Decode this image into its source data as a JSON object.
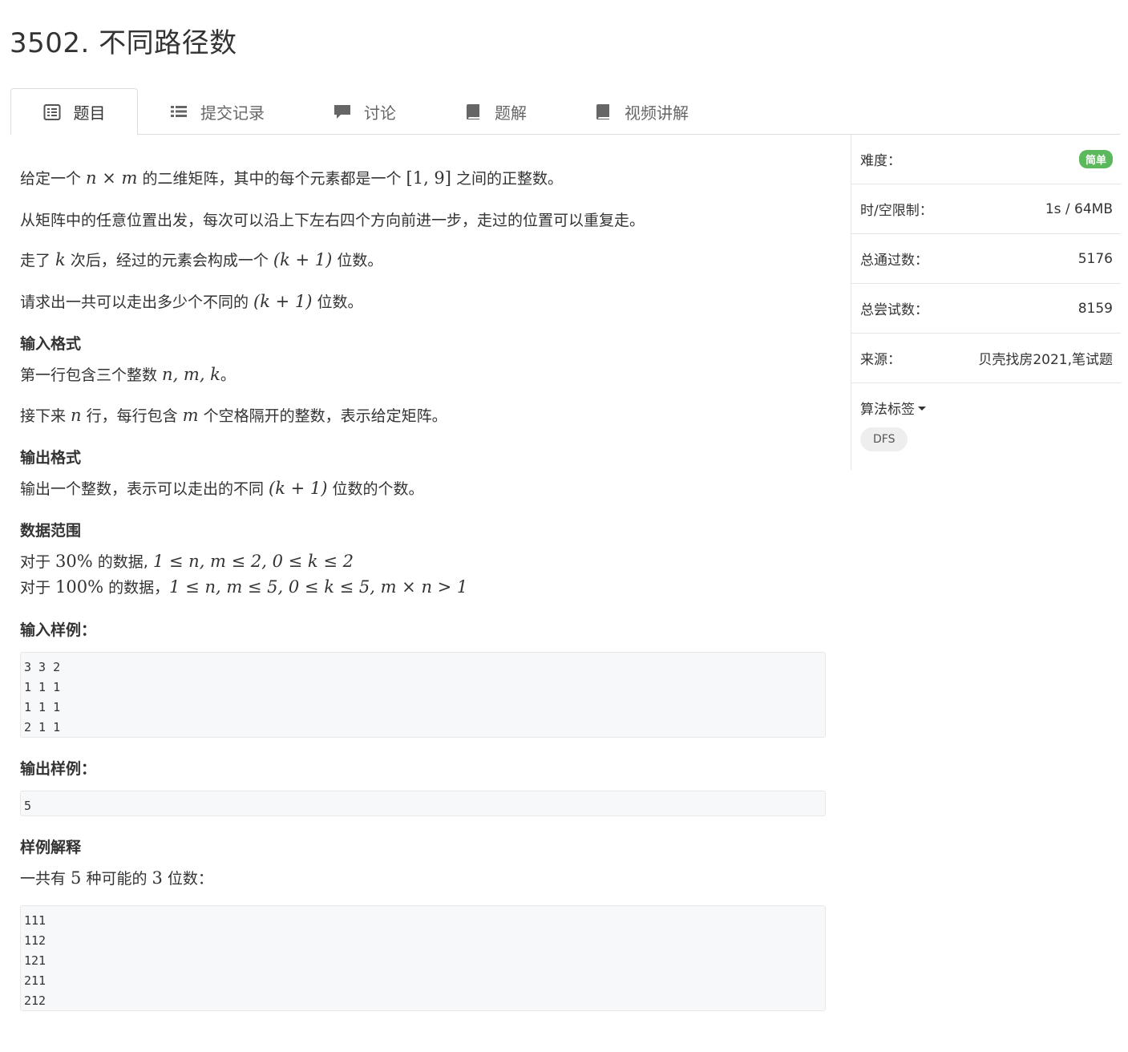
{
  "title": "3502. 不同路径数",
  "tabs": [
    {
      "label": "题目",
      "icon": "list-alt-icon",
      "active": true
    },
    {
      "label": "提交记录",
      "icon": "list-icon",
      "active": false
    },
    {
      "label": "讨论",
      "icon": "comment-icon",
      "active": false
    },
    {
      "label": "题解",
      "icon": "book-icon",
      "active": false
    },
    {
      "label": "视频讲解",
      "icon": "book-icon",
      "active": false
    }
  ],
  "problem": {
    "p1": {
      "a": "给定一个 ",
      "m1": "n × m",
      "b": " 的二维矩阵，其中的每个元素都是一个 ",
      "m2": "[1, 9]",
      "c": " 之间的正整数。"
    },
    "p2": "从矩阵中的任意位置出发，每次可以沿上下左右四个方向前进一步，走过的位置可以重复走。",
    "p3": {
      "a": "走了 ",
      "m1": "k",
      "b": " 次后，经过的元素会构成一个 ",
      "m2": "(k + 1)",
      "c": " 位数。"
    },
    "p4": {
      "a": "请求出一共可以走出多少个不同的 ",
      "m1": "(k + 1)",
      "b": " 位数。"
    },
    "input_heading": "输入格式",
    "input1": {
      "a": "第一行包含三个整数 ",
      "m1": "n, m, k",
      "b": "。"
    },
    "input2": {
      "a": "接下来 ",
      "m1": "n",
      "b": " 行，每行包含 ",
      "m2": "m",
      "c": " 个空格隔开的整数，表示给定矩阵。"
    },
    "output_heading": "输出格式",
    "output1": {
      "a": "输出一个整数，表示可以走出的不同 ",
      "m1": "(k + 1)",
      "b": " 位数的个数。"
    },
    "range_heading": "数据范围",
    "range1": {
      "a": "对于 ",
      "m1": "30%",
      "b": " 的数据, ",
      "m2": "1 ≤ n, m ≤ 2, 0 ≤ k ≤ 2"
    },
    "range2": {
      "a": "对于 ",
      "m1": "100%",
      "b": " 的数据，",
      "m2": "1 ≤ n, m ≤ 5, 0 ≤ k ≤ 5, m × n > 1"
    },
    "sample_input_heading": "输入样例：",
    "sample_input": "3 3 2\n1 1 1\n1 1 1\n2 1 1",
    "sample_output_heading": "输出样例：",
    "sample_output": "5",
    "explain_heading": "样例解释",
    "explain1": {
      "a": "一共有 ",
      "m1": "5",
      "b": " 种可能的 ",
      "m2": "3",
      "c": " 位数："
    },
    "explain_block": "111\n112\n121\n211\n212"
  },
  "sidebar": {
    "difficulty_label": "难度：",
    "difficulty_value": "简单",
    "limit_label": "时/空限制：",
    "limit_value": "1s / 64MB",
    "passed_label": "总通过数：",
    "passed_value": "5176",
    "tried_label": "总尝试数：",
    "tried_value": "8159",
    "source_label": "来源：",
    "source_value": "贝壳找房2021,笔试题",
    "algo_label": "算法标签",
    "tags": [
      "DFS"
    ]
  },
  "colors": {
    "badge": "#5cb85c",
    "code_bg": "#f6f8fa",
    "border": "#dddddd"
  }
}
